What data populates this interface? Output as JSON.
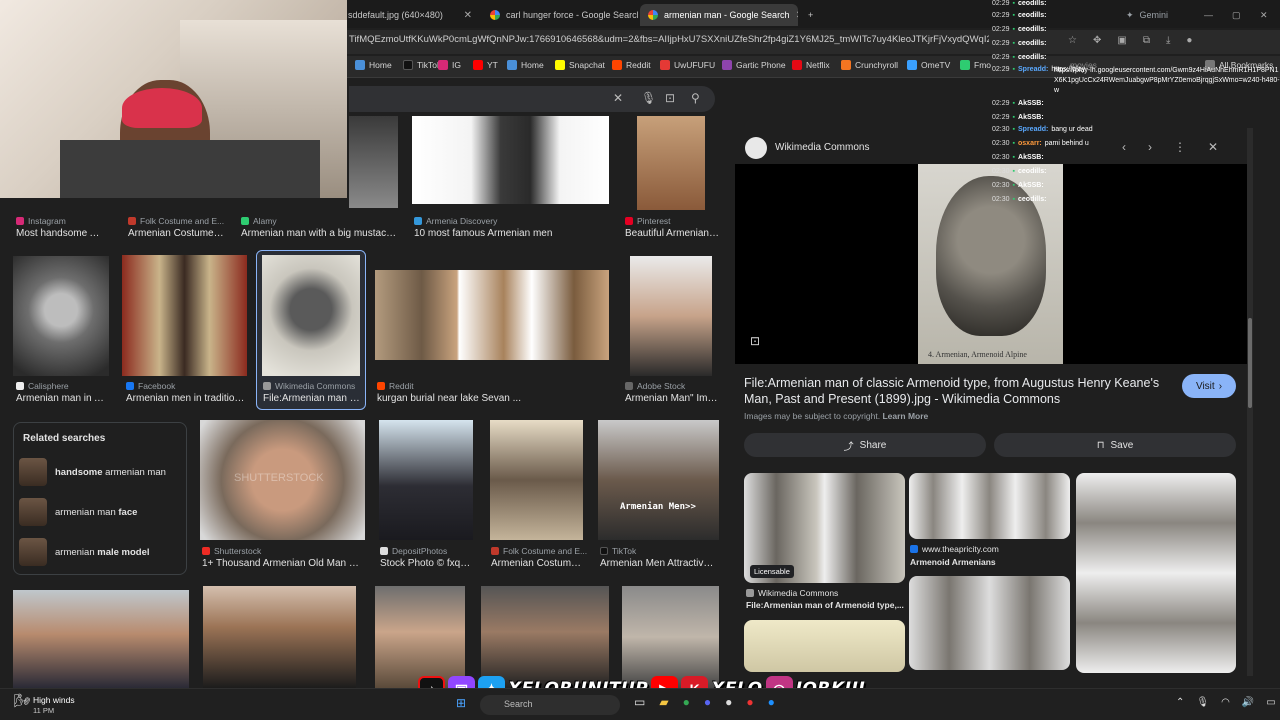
{
  "tabs": [
    {
      "title": "sddefault.jpg (640×480)",
      "active": false
    },
    {
      "title": "carl hunger force - Google Search",
      "active": false
    },
    {
      "title": "armenian man - Google Search",
      "active": true
    }
  ],
  "gemini_label": "Gemini",
  "url": "TifMQEzmoUtfKKuWkP0cmLgWfQnNPJw:1766910646568&udm=2&fbs=AIIjpHxU7SXXniUZfeShr2fp4giZ1Y6MJ25_tmWITc7uy4KleoJTKjrFjVxydQWqI2NcOhZ",
  "bookmarks": [
    {
      "label": "Home",
      "color": "#4a90d9"
    },
    {
      "label": "TikTok",
      "color": "#111111"
    },
    {
      "label": "IG",
      "color": "#d62976"
    },
    {
      "label": "YT",
      "color": "#ff0000"
    },
    {
      "label": "Home",
      "color": "#4a90d9"
    },
    {
      "label": "Snapchat",
      "color": "#fffc00"
    },
    {
      "label": "Reddit",
      "color": "#ff4500"
    },
    {
      "label": "UwUFUFU",
      "color": "#e53935"
    },
    {
      "label": "Gartic Phone",
      "color": "#8e44ad"
    },
    {
      "label": "Netflix",
      "color": "#e50914"
    },
    {
      "label": "Crunchyroll",
      "color": "#f47521"
    },
    {
      "label": "OmeTV",
      "color": "#3aa0ff"
    },
    {
      "label": "Fmo",
      "color": "#2ecc71"
    }
  ],
  "all_bookmarks_label": "All Bookmarks",
  "movies_label": "movies",
  "lens_url": "https://play-lh.googleusercontent.com/Gwm9z4HiAuNhEhmR1H1P8PN1X6K1pgUcCx24RWemJuabgwP8pMrYZ0emoBjrqgjSxWmo=w240-h480-rw",
  "results_row1": [
    {
      "source": "Instagram",
      "title": "Most handsome Ar...",
      "fav": "#d62976"
    },
    {
      "source": "Folk Costume and E...",
      "title": "Armenian Costume ...",
      "fav": "#c0392b"
    },
    {
      "source": "Alamy",
      "title": "Armenian man with a big mustach...",
      "fav": "#2ecc71"
    },
    {
      "source": "Armenia Discovery",
      "title": "10 most famous Armenian men",
      "fav": "#3498db"
    },
    {
      "source": "Pinterest",
      "title": "Beautiful Armenian ...",
      "fav": "#e60023"
    }
  ],
  "results_row2": [
    {
      "source": "Calisphere",
      "title": "Armenian man in Ar...",
      "fav": "#eeeeee"
    },
    {
      "source": "Facebook",
      "title": "Armenian men in tradition...",
      "fav": "#1877f2"
    },
    {
      "source": "Wikimedia Commons",
      "title": "File:Armenian man o...",
      "fav": "#999999"
    },
    {
      "source": "Reddit",
      "title": "kurgan burial near lake Sevan ...",
      "fav": "#ff4500"
    },
    {
      "source": "Adobe Stock",
      "title": "Armenian Man\" Ima...",
      "fav": "#666666"
    }
  ],
  "results_row3": [
    {
      "source": "Shutterstock",
      "title": "1+ Thousand Armenian Old Man Ro...",
      "fav": "#ee2b24"
    },
    {
      "source": "DepositPhotos",
      "title": "Stock Photo © fxqu...",
      "fav": "#dddddd"
    },
    {
      "source": "Folk Costume and E...",
      "title": "Armenian Costume ...",
      "fav": "#c0392b"
    },
    {
      "source": "TikTok",
      "title": "Armenian Men Attractive ...",
      "fav": "#111111"
    }
  ],
  "watermark_shutterstock": "SHUTTERSTOCK",
  "watermark_tiktok": "Armenian Men>>",
  "related": {
    "title": "Related searches",
    "items": [
      {
        "bold": "handsome",
        "rest": " armenian man"
      },
      {
        "bold": "",
        "rest": "armenian man ",
        "bold2": "face"
      },
      {
        "bold": "",
        "rest": "armenian ",
        "bold2": "male model"
      }
    ]
  },
  "panel": {
    "source": "Wikimedia Commons",
    "caption": "4.  Armenian, Armenoid Alpine",
    "title": "File:Armenian man of classic Armenoid type, from Augustus Henry Keane's Man, Past and Present (1899).jpg - Wikimedia Commons",
    "visit_label": "Visit",
    "copyright": "Images may be subject to copyright.",
    "learn_more": "Learn More",
    "share_label": "Share",
    "save_label": "Save",
    "licensable": "Licensable",
    "related_cards": [
      {
        "source": "Wikimedia Commons",
        "title": "File:Armenian man of Armenoid type,..."
      },
      {
        "source": "www.theapricity.com",
        "title": "Armenoid Armenians"
      }
    ]
  },
  "chat": [
    {
      "time": "02:29",
      "user": "ceodills:",
      "msg": "",
      "color": "#ffffff"
    },
    {
      "time": "02:29",
      "user": "ceodills:",
      "msg": "",
      "color": "#ffffff"
    },
    {
      "time": "02:29",
      "user": "ceodills:",
      "msg": "",
      "color": "#ffffff"
    },
    {
      "time": "02:29",
      "user": "ceodills:",
      "msg": "",
      "color": "#ffffff"
    },
    {
      "time": "02:29",
      "user": "ceodills:",
      "msg": "",
      "color": "#ffffff"
    },
    {
      "time": "02:29",
      "user": "Spreadd:",
      "msg": "https://play-",
      "color": "#5aa9ff"
    },
    {
      "time": "02:29",
      "user": "AkSSB:",
      "msg": "",
      "color": "#ffffff"
    },
    {
      "time": "02:29",
      "user": "AkSSB:",
      "msg": "",
      "color": "#ffffff"
    },
    {
      "time": "02:30",
      "user": "Spreadd:",
      "msg": "bang ur dead",
      "color": "#5aa9ff"
    },
    {
      "time": "02:30",
      "user": "osxarr:",
      "msg": "pami behind u",
      "color": "#ff9a3c"
    },
    {
      "time": "02:30",
      "user": "AkSSB:",
      "msg": "",
      "color": "#ffffff"
    },
    {
      "time": "02:30",
      "user": "ceodills:",
      "msg": "",
      "color": "#ffffff"
    },
    {
      "time": "02:30",
      "user": "AkSSB:",
      "msg": "",
      "color": "#ffffff"
    },
    {
      "time": "02:30",
      "user": "ceodills:",
      "msg": "",
      "color": "#ffffff"
    }
  ],
  "banner_text": "XELORUNITUP",
  "banner_text2": "XELO",
  "banner_text3": "JORKIII",
  "taskbar": {
    "weather": "High winds",
    "weather_sub": "11 PM",
    "search_placeholder": "Search"
  }
}
